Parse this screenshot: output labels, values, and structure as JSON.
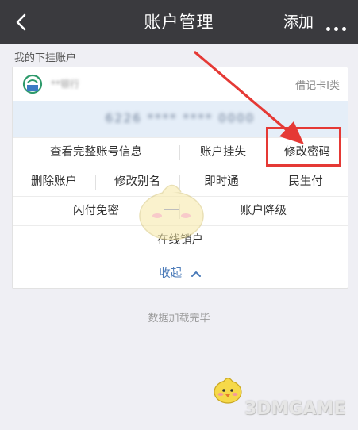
{
  "header": {
    "back_icon": "chevron-left-icon",
    "title": "账户管理",
    "add_label": "添加",
    "more_icon": "more-dots-icon"
  },
  "section_label": "我的下挂账户",
  "account": {
    "bank_name": "**银行",
    "card_type": "借记卡I类",
    "number_masked": "6226 **** **** 0000"
  },
  "actions": {
    "row1": [
      "查看完整账号信息",
      "账户挂失",
      "修改密码"
    ],
    "row2": [
      "删除账户",
      "修改别名",
      "即时通",
      "民生付"
    ],
    "row3": [
      "闪付免密",
      "账户降级"
    ],
    "row4": [
      "在线销户"
    ]
  },
  "collapse_label": "收起",
  "status_text": "数据加载完毕",
  "watermark": "3DMGAME",
  "colors": {
    "header_bg": "#3a3a3e",
    "page_bg": "#efeff4",
    "band_bg": "#e5eef8",
    "link": "#4a7ab8",
    "annotation": "#e53935"
  }
}
